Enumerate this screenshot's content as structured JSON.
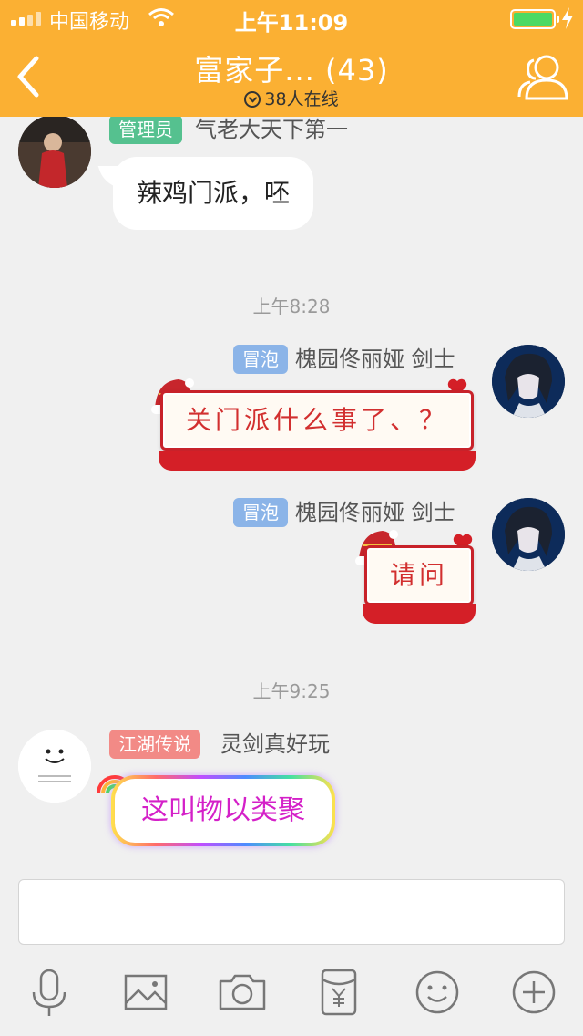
{
  "status_bar": {
    "carrier": "中国移动",
    "time": "上午11:09"
  },
  "header": {
    "back_icon": "chevron-left-icon",
    "title": "富家子... (43)",
    "online_text": "38人在线",
    "members_icon": "group-members-icon",
    "bg_color": "#fbb033"
  },
  "messages": [
    {
      "side": "left",
      "tag": "管理员",
      "tag_color": "#55c18f",
      "nick": "气老大天下第一",
      "text": "辣鸡门派，呸",
      "style": "plain"
    },
    {
      "timestamp": "上午8:28"
    },
    {
      "side": "right",
      "tag": "冒泡",
      "tag_color": "#8bb4e8",
      "nick": "槐园佟丽娅 剑士",
      "text": "关门派什么事了、？",
      "style": "festive"
    },
    {
      "side": "right",
      "tag": "冒泡",
      "tag_color": "#8bb4e8",
      "nick": "槐园佟丽娅 剑士",
      "text": "请问",
      "style": "festive"
    },
    {
      "timestamp": "上午9:25"
    },
    {
      "side": "left",
      "tag": "江湖传说",
      "tag_color": "#f28a86",
      "nick": "灵剑真好玩",
      "text": "这叫物以类聚",
      "style": "rainbow"
    }
  ],
  "input": {
    "value": "",
    "placeholder": ""
  },
  "toolbar": [
    {
      "icon": "microphone-icon"
    },
    {
      "icon": "image-icon"
    },
    {
      "icon": "camera-icon"
    },
    {
      "icon": "red-packet-icon"
    },
    {
      "icon": "emoji-icon"
    },
    {
      "icon": "plus-icon"
    }
  ]
}
